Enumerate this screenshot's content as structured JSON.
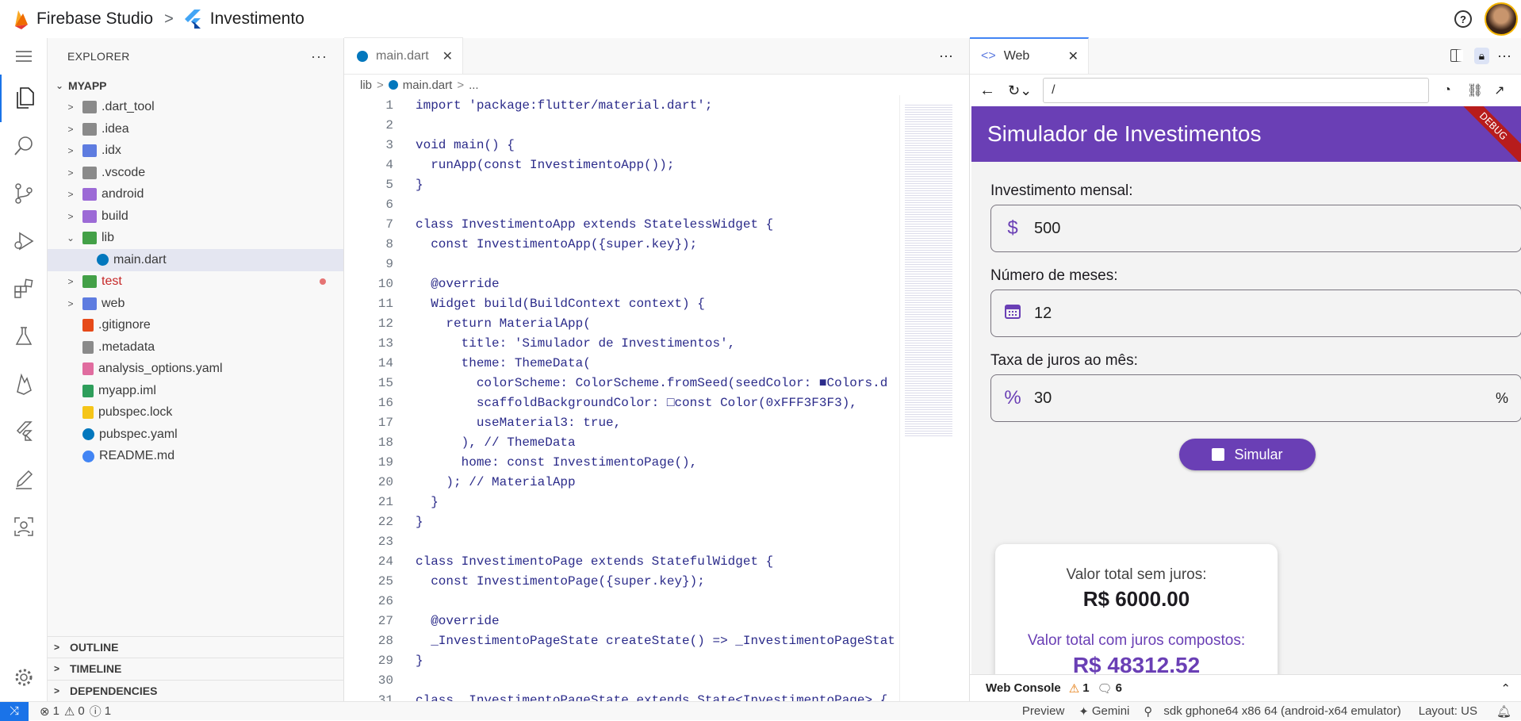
{
  "topbar": {
    "brand": "Firebase Studio",
    "separator": ">",
    "project": "Investimento"
  },
  "explorer": {
    "title": "EXPLORER",
    "root": "MYAPP",
    "items": [
      {
        "label": ".dart_tool",
        "type": "folder",
        "color": "#8a8a8a"
      },
      {
        "label": ".idea",
        "type": "folder",
        "color": "#8a8a8a"
      },
      {
        "label": ".idx",
        "type": "folder",
        "color": "#5e7ce0"
      },
      {
        "label": ".vscode",
        "type": "folder",
        "color": "#8a8a8a"
      },
      {
        "label": "android",
        "type": "folder",
        "color": "#9c6ad6"
      },
      {
        "label": "build",
        "type": "folder",
        "color": "#9c6ad6"
      },
      {
        "label": "lib",
        "type": "folder-open",
        "color": "#43a047"
      },
      {
        "label": "main.dart",
        "type": "file",
        "color": "#0277bd"
      },
      {
        "label": "test",
        "type": "folder",
        "color": "#43a047",
        "modified": true
      },
      {
        "label": "web",
        "type": "folder",
        "color": "#5e7ce0"
      },
      {
        "label": ".gitignore",
        "type": "file",
        "color": "#e64a19"
      },
      {
        "label": ".metadata",
        "type": "file",
        "color": "#8a8a8a"
      },
      {
        "label": "analysis_options.yaml",
        "type": "file",
        "color": "#e06c9f"
      },
      {
        "label": "myapp.iml",
        "type": "file",
        "color": "#2e9e5b"
      },
      {
        "label": "pubspec.lock",
        "type": "file",
        "color": "#f5c518"
      },
      {
        "label": "pubspec.yaml",
        "type": "file",
        "color": "#0277bd"
      },
      {
        "label": "README.md",
        "type": "file",
        "color": "#4285f4"
      }
    ],
    "sections": [
      "OUTLINE",
      "TIMELINE",
      "DEPENDENCIES"
    ]
  },
  "editor": {
    "tab": "main.dart",
    "breadcrumb": [
      "lib",
      "main.dart",
      "..."
    ],
    "lines": [
      "import 'package:flutter/material.dart';",
      "",
      "void main() {",
      "  runApp(const InvestimentoApp());",
      "}",
      "",
      "class InvestimentoApp extends StatelessWidget {",
      "  const InvestimentoApp({super.key});",
      "",
      "  @override",
      "  Widget build(BuildContext context) {",
      "    return MaterialApp(",
      "      title: 'Simulador de Investimentos',",
      "      theme: ThemeData(",
      "        colorScheme: ColorScheme.fromSeed(seedColor: ■Colors.d",
      "        scaffoldBackgroundColor: □const Color(0xFFF3F3F3),",
      "        useMaterial3: true,",
      "      ), // ThemeData",
      "      home: const InvestimentoPage(),",
      "    ); // MaterialApp",
      "  }",
      "}",
      "",
      "class InvestimentoPage extends StatefulWidget {",
      "  const InvestimentoPage({super.key});",
      "",
      "  @override",
      "  _InvestimentoPageState createState() => _InvestimentoPageStat",
      "}",
      "",
      "class _InvestimentoPageState extends State<InvestimentoPage> {"
    ]
  },
  "web": {
    "tab": "Web",
    "url": "/",
    "app": {
      "title": "Simulador de Investimentos",
      "debug": "DEBUG",
      "fields": [
        {
          "label": "Investimento mensal:",
          "prefix": "$",
          "value": "500",
          "suffix": ""
        },
        {
          "label": "Número de meses:",
          "prefix": "calendar",
          "value": "12",
          "suffix": ""
        },
        {
          "label": "Taxa de juros ao mês:",
          "prefix": "%",
          "value": "30",
          "suffix": "%"
        }
      ],
      "button": "Simular",
      "result": {
        "label1": "Valor total sem juros:",
        "value1": "R$ 6000.00",
        "label2": "Valor total com juros compostos:",
        "value2": "R$ 48312.52"
      }
    },
    "console": {
      "label": "Web Console",
      "warnings": "1",
      "messages": "6"
    }
  },
  "status": {
    "errors": "1",
    "warnings": "0",
    "infos": "1",
    "preview": "Preview",
    "gemini": "Gemini",
    "device": "sdk gphone64 x86 64 (android-x64 emulator)",
    "layout": "Layout: US"
  },
  "colors": {
    "accent": "#6a3fb5",
    "debug": "#b71c1c"
  }
}
